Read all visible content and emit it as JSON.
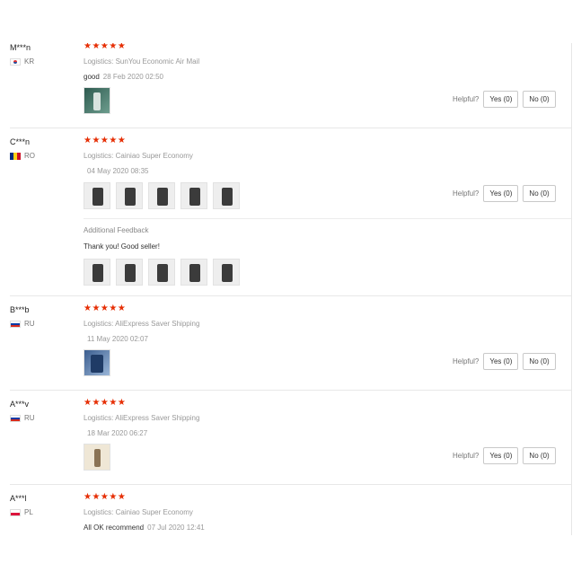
{
  "helpful_label": "Helpful?",
  "star_color": "#e62e04",
  "stars_text": "★★★★★",
  "reviews": [
    {
      "user": "M***n",
      "country": "KR",
      "flag": "kr",
      "rating": 5,
      "logistics_label": "Logistics:",
      "logistics": "SunYou Economic Air Mail",
      "text": "good",
      "date": "28 Feb 2020 02:50",
      "photos": 1,
      "yes": "Yes (0)",
      "no": "No (0)"
    },
    {
      "user": "C***n",
      "country": "RO",
      "flag": "ro",
      "rating": 5,
      "logistics_label": "Logistics:",
      "logistics": "Cainiao Super Economy",
      "text": "",
      "date": "04 May 2020 08:35",
      "photos": 5,
      "yes": "Yes (0)",
      "no": "No (0)",
      "additional_title": "Additional Feedback",
      "additional_text": "Thank you! Good seller!",
      "additional_photos": 5
    },
    {
      "user": "B***b",
      "country": "RU",
      "flag": "ru",
      "rating": 5,
      "logistics_label": "Logistics:",
      "logistics": "AliExpress Saver Shipping",
      "text": "",
      "date": "11 May 2020 02:07",
      "photos": 1,
      "yes": "Yes (0)",
      "no": "No (0)"
    },
    {
      "user": "A***v",
      "country": "RU",
      "flag": "ru",
      "rating": 5,
      "logistics_label": "Logistics:",
      "logistics": "AliExpress Saver Shipping",
      "text": "",
      "date": "18 Mar 2020 06:27",
      "photos": 1,
      "yes": "Yes (0)",
      "no": "No (0)"
    },
    {
      "user": "A***l",
      "country": "PL",
      "flag": "pl",
      "rating": 5,
      "logistics_label": "Logistics:",
      "logistics": "Cainiao Super Economy",
      "text": "All OK recommend",
      "date": "07 Jul 2020 12:41"
    }
  ]
}
